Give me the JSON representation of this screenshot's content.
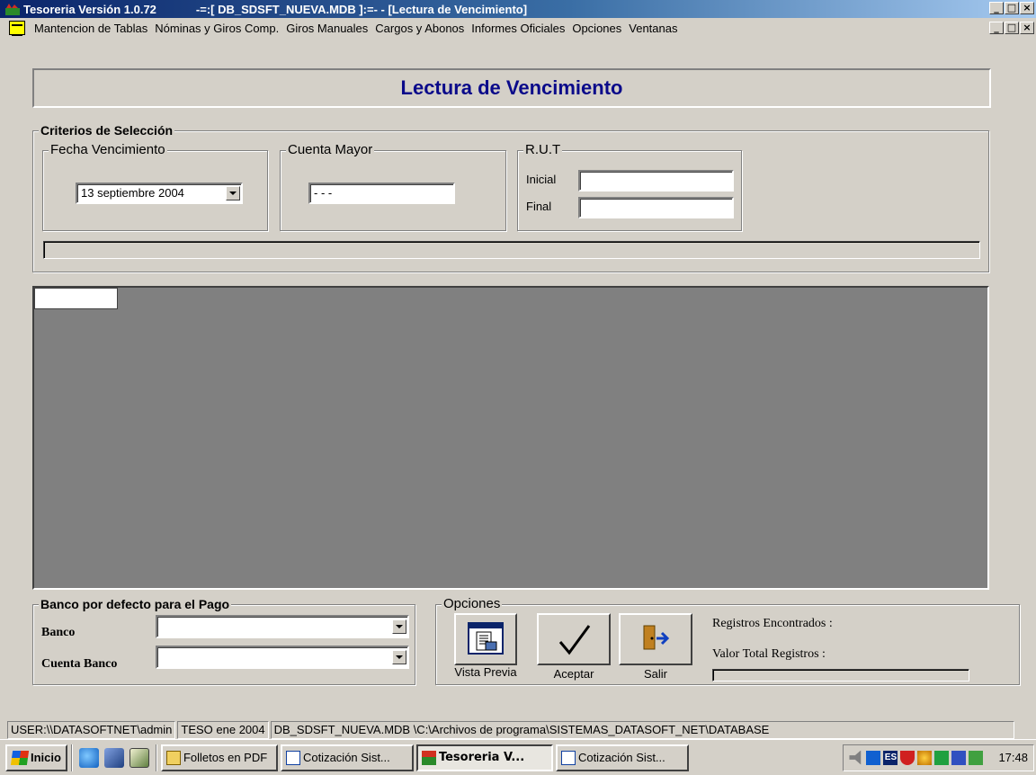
{
  "window": {
    "app_title": "Tesoreria  Versión 1.0.72",
    "db_title": "-=:[  DB_SDSFT_NUEVA.MDB  ]:=-  - [Lectura de Vencimiento]",
    "btn_min": "_",
    "btn_max": "□",
    "btn_close": "×"
  },
  "menu": {
    "items": [
      "Mantencion de Tablas",
      "Nóminas y Giros Comp.",
      "Giros Manuales",
      "Cargos y Abonos",
      "Informes Oficiales",
      "Opciones",
      "Ventanas"
    ]
  },
  "form": {
    "title": "Lectura de Vencimiento",
    "criteria": {
      "legend": "Criterios de Selección",
      "fecha": {
        "legend": "Fecha Vencimiento",
        "value": "13 septiembre 2004"
      },
      "cuenta": {
        "legend": "Cuenta Mayor",
        "value": "- - -"
      },
      "rut": {
        "legend": "R.U.T",
        "inicial_label": "Inicial",
        "final_label": "Final",
        "inicial_value": "",
        "final_value": ""
      }
    },
    "banco": {
      "legend": "Banco por defecto para el Pago",
      "banco_label": "Banco",
      "cuenta_label": "Cuenta Banco",
      "banco_value": "",
      "cuenta_value": ""
    },
    "opciones": {
      "legend": "Opciones",
      "vista_previa": "Vista Previa",
      "aceptar": "Aceptar",
      "salir": "Salir"
    },
    "summary": {
      "registros_label": "Registros Encontrados :",
      "valor_label": "Valor Total Registros :"
    }
  },
  "statusbar": {
    "user": "USER:\\\\DATASOFTNET\\admin",
    "period": "TESO ene 2004",
    "path": "DB_SDSFT_NUEVA.MDB \\C:\\Archivos de programa\\SISTEMAS_DATASOFT_NET\\DATABASE"
  },
  "taskbar": {
    "start": "Inicio",
    "tasks": [
      "Folletos en PDF",
      "Cotización Sist...",
      "Tesoreria  V...",
      "Cotización Sist..."
    ],
    "clock": "17:48",
    "tray_lang": "ES"
  },
  "colors": {
    "title_gradient_start": "#0a246a",
    "form_title": "#0a0a8a",
    "grid_background": "#808080",
    "face": "#d4d0c8"
  }
}
